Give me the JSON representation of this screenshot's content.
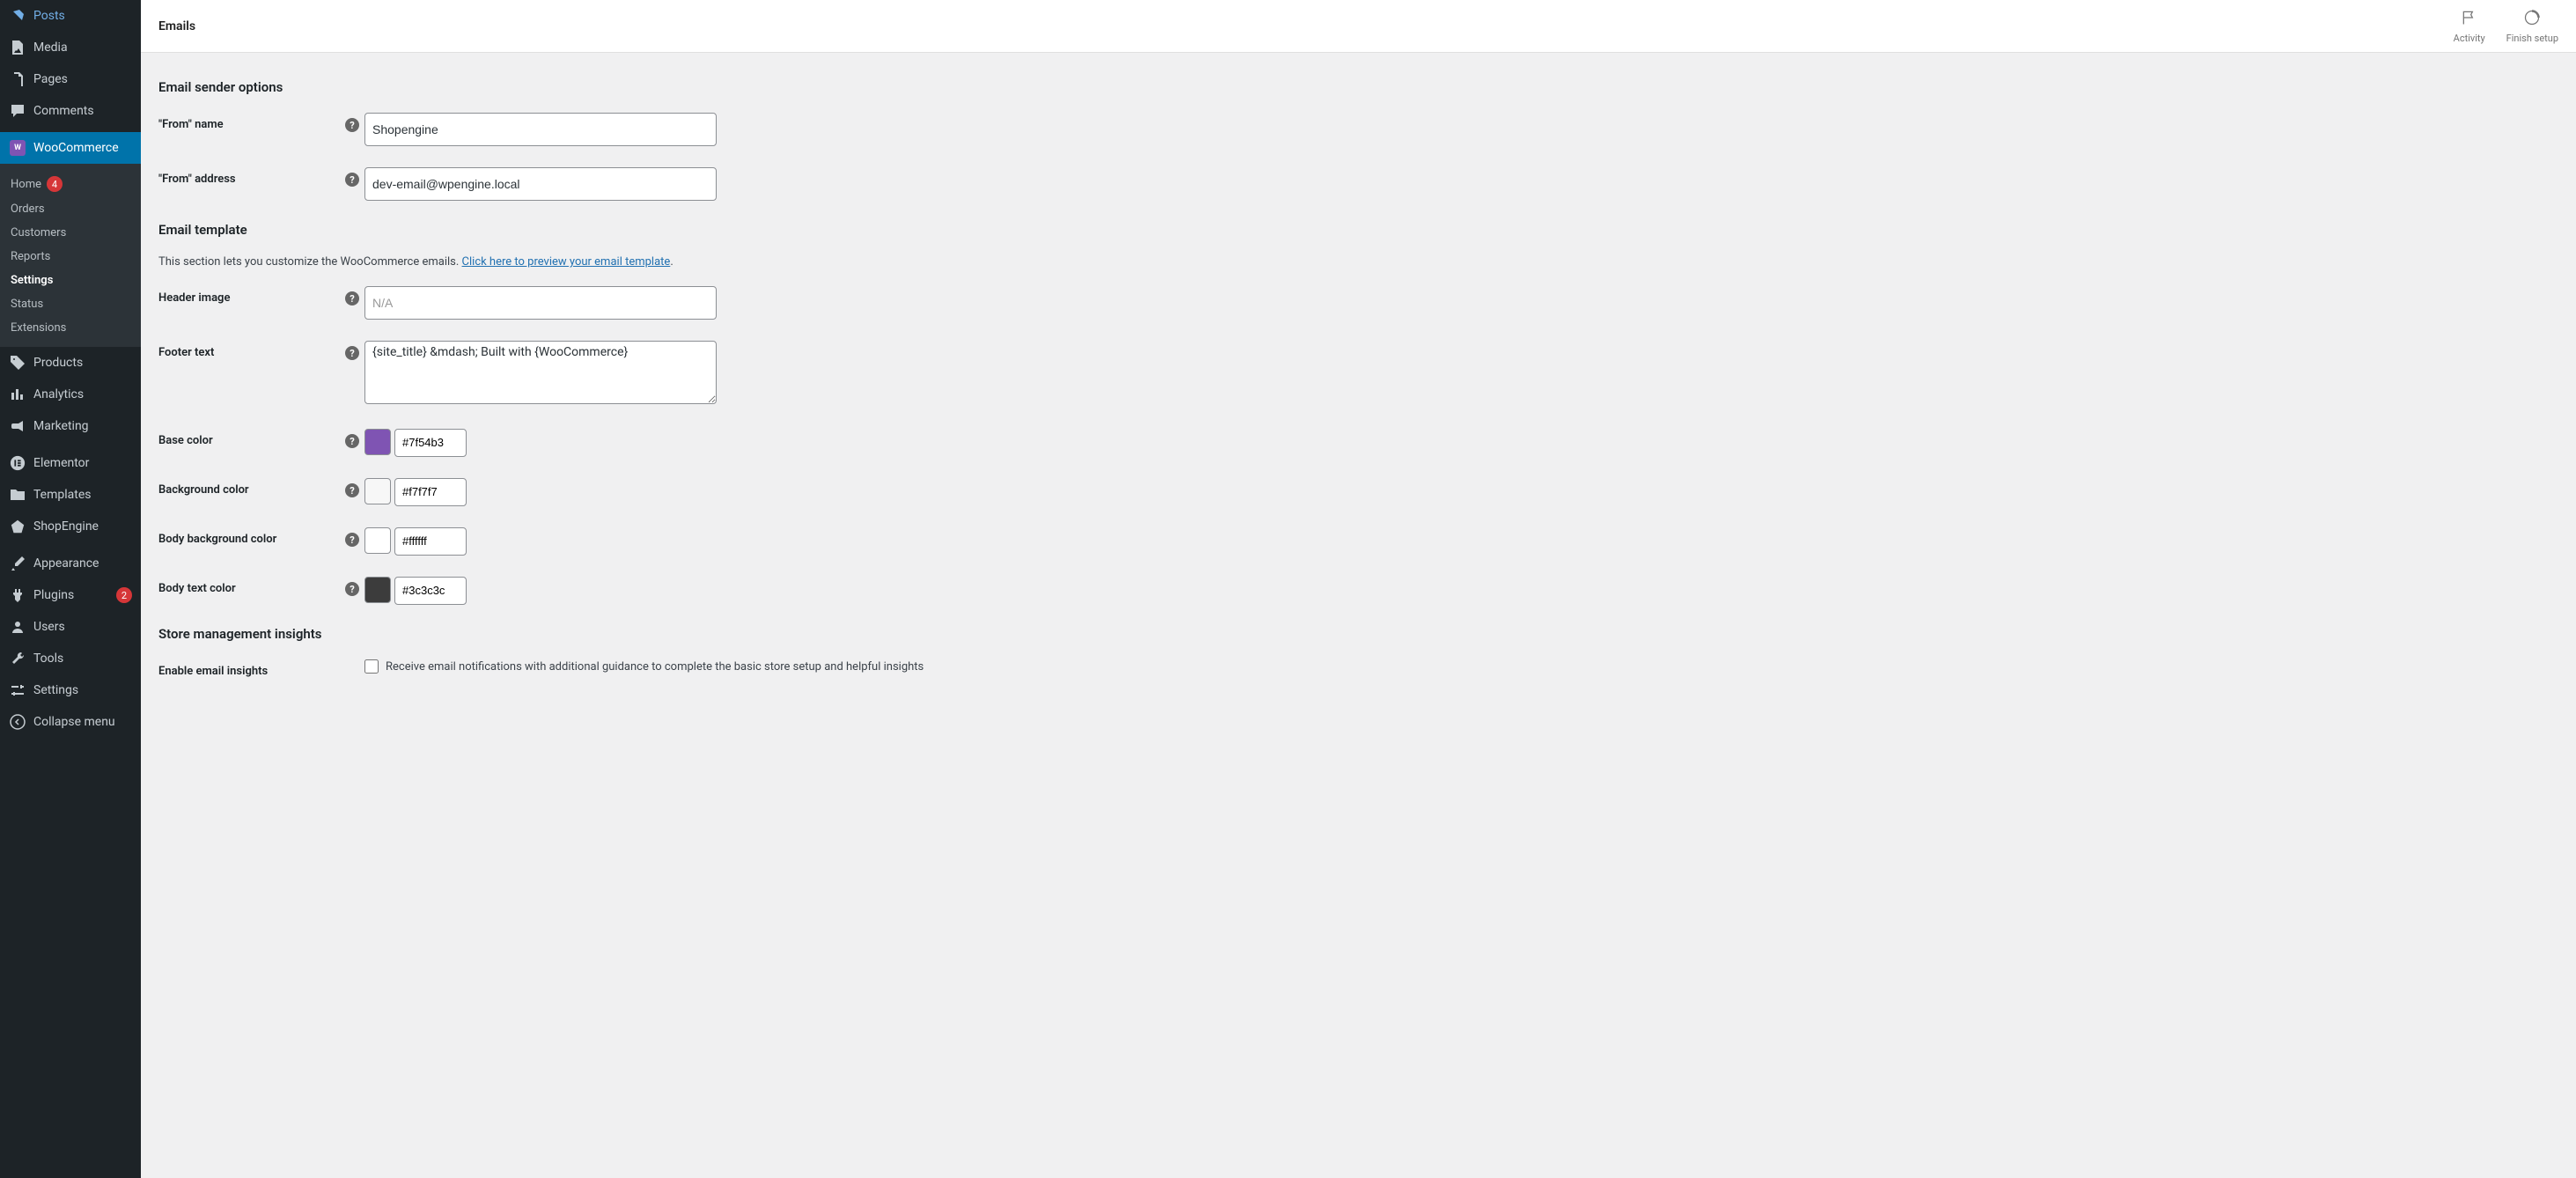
{
  "topbar": {
    "title": "Emails",
    "activity": "Activity",
    "finish_setup": "Finish setup"
  },
  "sidebar": {
    "posts": "Posts",
    "media": "Media",
    "pages": "Pages",
    "comments": "Comments",
    "woocommerce": "WooCommerce",
    "products": "Products",
    "analytics": "Analytics",
    "marketing": "Marketing",
    "elementor": "Elementor",
    "templates": "Templates",
    "shopengine": "ShopEngine",
    "appearance": "Appearance",
    "plugins": "Plugins",
    "plugins_count": "2",
    "users": "Users",
    "tools": "Tools",
    "settings_main": "Settings",
    "collapse": "Collapse menu"
  },
  "submenu": {
    "home": "Home",
    "home_count": "4",
    "orders": "Orders",
    "customers": "Customers",
    "reports": "Reports",
    "settings": "Settings",
    "status": "Status",
    "extensions": "Extensions"
  },
  "sections": {
    "sender_title": "Email sender options",
    "template_title": "Email template",
    "template_desc": "This section lets you customize the WooCommerce emails. ",
    "template_link": "Click here to preview your email template",
    "template_desc_end": ".",
    "insights_title": "Store management insights"
  },
  "fields": {
    "from_name": {
      "label": "\"From\" name",
      "value": "Shopengine"
    },
    "from_address": {
      "label": "\"From\" address",
      "value": "dev-email@wpengine.local"
    },
    "header_image": {
      "label": "Header image",
      "placeholder": "N/A",
      "value": ""
    },
    "footer_text": {
      "label": "Footer text",
      "value": "{site_title} &mdash; Built with {WooCommerce}"
    },
    "base_color": {
      "label": "Base color",
      "value": "#7f54b3"
    },
    "bg_color": {
      "label": "Background color",
      "value": "#f7f7f7"
    },
    "body_bg_color": {
      "label": "Body background color",
      "value": "#ffffff"
    },
    "body_text_color": {
      "label": "Body text color",
      "value": "#3c3c3c"
    },
    "enable_insights": {
      "label": "Enable email insights",
      "desc": "Receive email notifications with additional guidance to complete the basic store setup and helpful insights"
    }
  }
}
